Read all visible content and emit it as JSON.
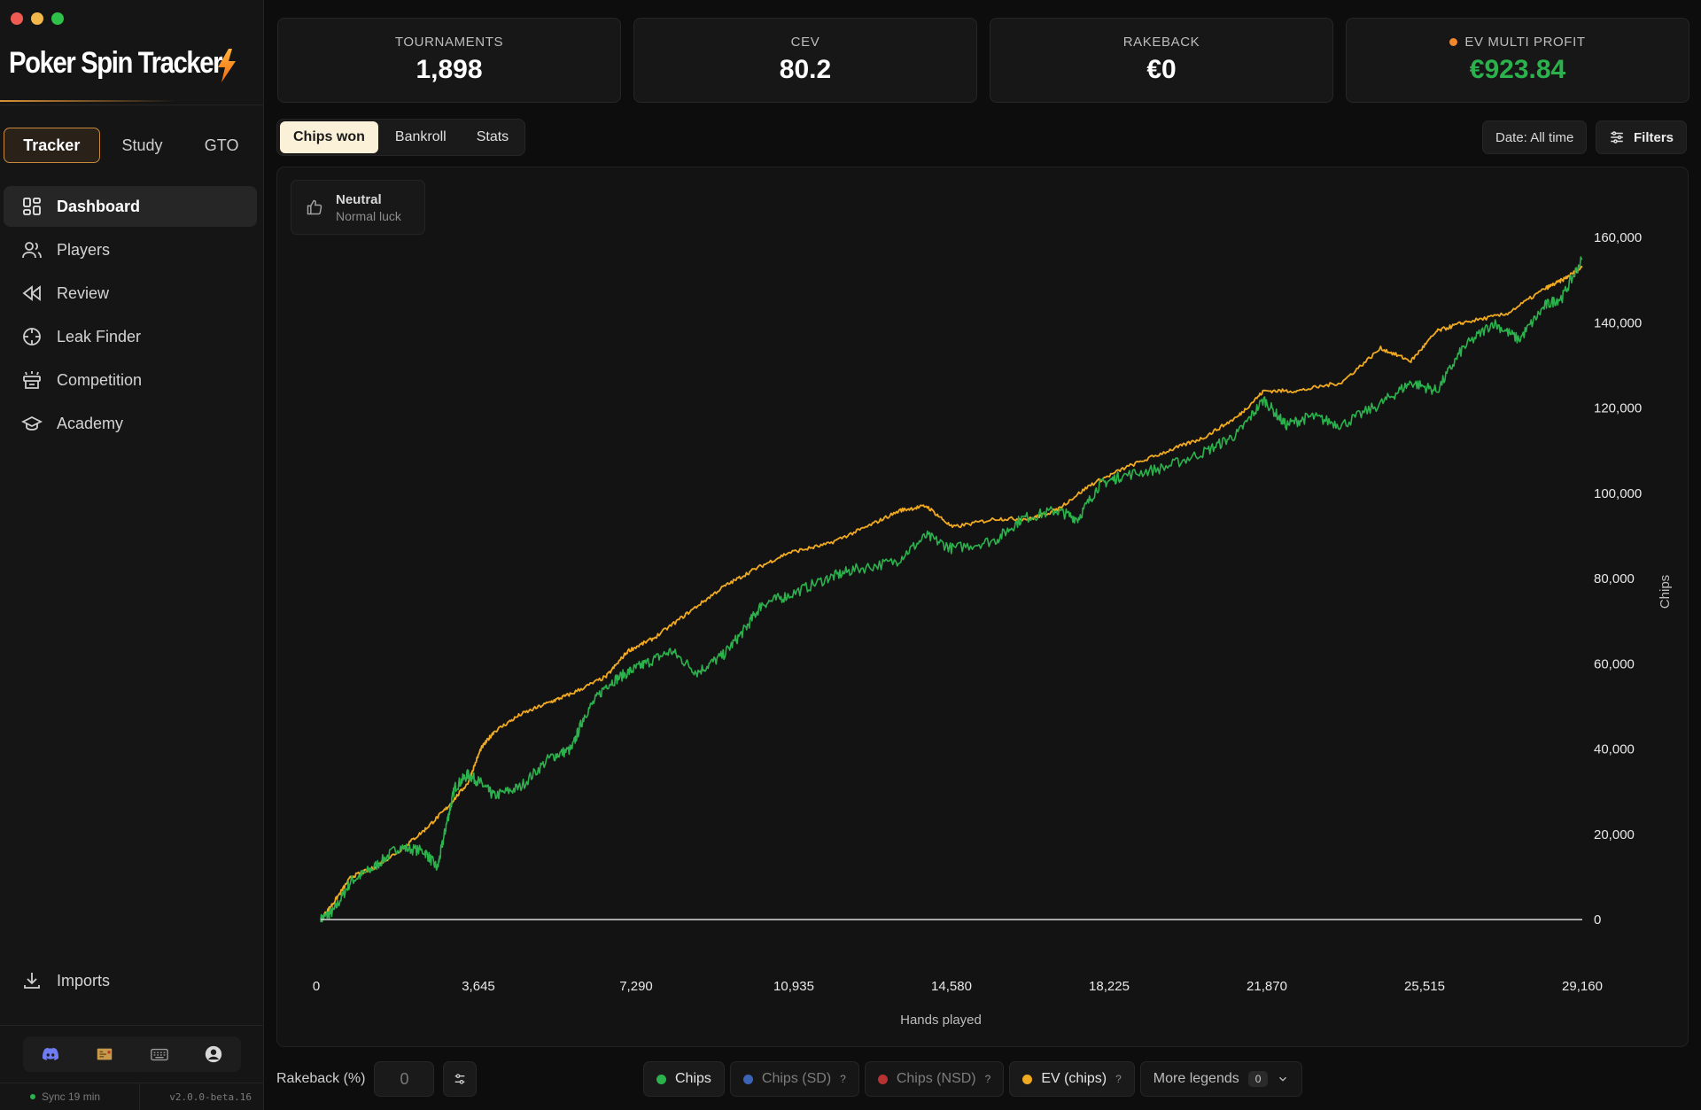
{
  "app": {
    "name": "Poker Spin Tracker",
    "sync_status": "Sync 19 min",
    "version": "v2.0.0-beta.16"
  },
  "mode_tabs": [
    {
      "label": "Tracker",
      "active": true
    },
    {
      "label": "Study",
      "active": false
    },
    {
      "label": "GTO",
      "active": false
    }
  ],
  "nav": {
    "items": [
      {
        "label": "Dashboard",
        "icon": "dashboard-grid-icon",
        "active": true
      },
      {
        "label": "Players",
        "icon": "users-icon",
        "active": false
      },
      {
        "label": "Review",
        "icon": "rewind-icon",
        "active": false
      },
      {
        "label": "Leak Finder",
        "icon": "crosshair-icon",
        "active": false
      },
      {
        "label": "Competition",
        "icon": "competition-icon",
        "active": false
      },
      {
        "label": "Academy",
        "icon": "graduation-cap-icon",
        "active": false
      }
    ],
    "imports_label": "Imports"
  },
  "utility_icons": [
    "discord-icon",
    "treasure-map-icon",
    "keyboard-icon",
    "account-icon"
  ],
  "stats": [
    {
      "label": "TOURNAMENTS",
      "value": "1,898"
    },
    {
      "label": "CEV",
      "value": "80.2"
    },
    {
      "label": "RAKEBACK",
      "value": "€0"
    },
    {
      "label": "EV MULTI PROFIT",
      "value": "€923.84"
    }
  ],
  "view_tabs": [
    {
      "label": "Chips won",
      "active": true
    },
    {
      "label": "Bankroll",
      "active": false
    },
    {
      "label": "Stats",
      "active": false
    }
  ],
  "date_filter": "Date: All time",
  "filters_label": "Filters",
  "luck": {
    "title": "Neutral",
    "subtitle": "Normal luck"
  },
  "bottom": {
    "rakeback_label": "Rakeback (%)",
    "rakeback_value": "0"
  },
  "legends": [
    {
      "label": "Chips",
      "color": "#2bb24c",
      "active": true,
      "help": ""
    },
    {
      "label": "Chips (SD)",
      "color": "#3b63b8",
      "active": false,
      "help": "?"
    },
    {
      "label": "Chips (NSD)",
      "color": "#b83232",
      "active": false,
      "help": "?"
    },
    {
      "label": "EV (chips)",
      "color": "#f0aa22",
      "active": true,
      "help": "?"
    }
  ],
  "more_legends": {
    "label": "More legends",
    "count": "0"
  },
  "colors": {
    "accent": "#f0aa22",
    "profit_green": "#2bb24c",
    "ev_dot": "#f0882e"
  },
  "chart_data": {
    "type": "line",
    "xlabel": "Hands played",
    "ylabel": "Chips",
    "xlim": [
      0,
      29160
    ],
    "ylim": [
      0,
      160000
    ],
    "x_ticks": [
      "0",
      "3,645",
      "7,290",
      "10,935",
      "14,580",
      "18,225",
      "21,870",
      "25,515",
      "29,160"
    ],
    "y_ticks": [
      "0",
      "20,000",
      "40,000",
      "60,000",
      "80,000",
      "100,000",
      "120,000",
      "140,000",
      "160,000"
    ],
    "grid": false,
    "series": [
      {
        "name": "Chips",
        "color": "#2bb24c",
        "x": [
          0,
          300,
          700,
          1200,
          1800,
          2400,
          2700,
          2900,
          3100,
          3400,
          3700,
          4000,
          4600,
          5300,
          5800,
          6100,
          6600,
          7100,
          7500,
          8100,
          8700,
          9300,
          9800,
          10200,
          10800,
          11700,
          12300,
          13300,
          14000,
          14600,
          15600,
          16200,
          17000,
          17500,
          18000,
          18500,
          19500,
          20500,
          21200,
          21800,
          22300,
          22900,
          23600,
          24500,
          25200,
          25800,
          26400,
          27100,
          27700,
          28300,
          28700,
          29160
        ],
        "y": [
          0,
          2000,
          9000,
          12000,
          17000,
          16000,
          12000,
          22000,
          31000,
          34000,
          32000,
          29000,
          31000,
          38000,
          40000,
          48000,
          55000,
          58000,
          60000,
          63000,
          58000,
          62000,
          68000,
          74000,
          76000,
          80000,
          82000,
          84000,
          90000,
          87000,
          89000,
          94000,
          96000,
          94000,
          102000,
          104000,
          106000,
          110000,
          114000,
          122000,
          116000,
          118000,
          116000,
          121000,
          126000,
          124000,
          134000,
          140000,
          136000,
          144000,
          146000,
          155000
        ]
      },
      {
        "name": "EV (chips)",
        "color": "#f0aa22",
        "x": [
          0,
          300,
          700,
          1200,
          1800,
          2400,
          2900,
          3400,
          3700,
          4000,
          4600,
          5300,
          5800,
          6600,
          7100,
          7700,
          8500,
          9300,
          10000,
          10800,
          11700,
          12600,
          13400,
          14000,
          14600,
          15600,
          16400,
          17000,
          17800,
          18600,
          19600,
          20400,
          21200,
          21800,
          22600,
          23600,
          24500,
          25200,
          25800,
          26400,
          27400,
          28300,
          28700,
          29160
        ],
        "y": [
          0,
          4000,
          10000,
          12000,
          16000,
          21000,
          26000,
          32000,
          40000,
          44000,
          48000,
          51000,
          53000,
          57000,
          63000,
          66000,
          72000,
          78000,
          82000,
          86000,
          88000,
          92000,
          96000,
          97000,
          92000,
          94000,
          94000,
          96000,
          102000,
          106000,
          110000,
          113000,
          118000,
          124000,
          124000,
          126000,
          134000,
          131000,
          138000,
          140000,
          142000,
          148000,
          150000,
          153000
        ]
      }
    ]
  }
}
